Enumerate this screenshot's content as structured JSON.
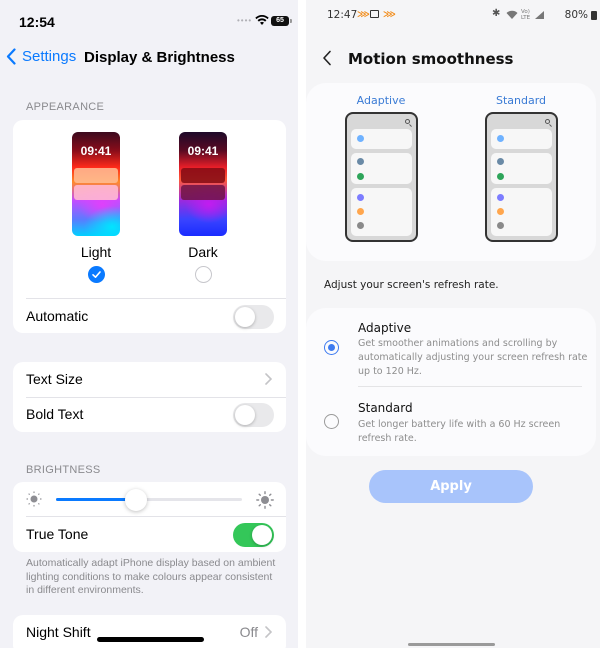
{
  "ios": {
    "status": {
      "time": "12:54",
      "battery": "65",
      "signal_icon": "cellular-dots-icon",
      "wifi_icon": "wifi-icon"
    },
    "nav": {
      "back_label": "Settings",
      "title": "Display & Brightness"
    },
    "appearance": {
      "section_label": "APPEARANCE",
      "options": [
        {
          "label": "Light",
          "preview_time": "09:41",
          "selected": true
        },
        {
          "label": "Dark",
          "preview_time": "09:41",
          "selected": false
        }
      ],
      "automatic": {
        "label": "Automatic",
        "on": false
      }
    },
    "text": {
      "text_size": {
        "label": "Text Size"
      },
      "bold_text": {
        "label": "Bold Text",
        "on": false
      }
    },
    "brightness": {
      "section_label": "BRIGHTNESS",
      "level": 0.43,
      "true_tone": {
        "label": "True Tone",
        "on": true
      },
      "footnote": "Automatically adapt iPhone display based on ambient lighting conditions to make colours appear consistent in different environments."
    },
    "night_shift": {
      "label": "Night Shift",
      "value": "Off"
    },
    "colors": {
      "accent": "#0a7aff",
      "toggle_on": "#34c759"
    }
  },
  "samsung": {
    "status": {
      "time": "12:47",
      "battery": "80%"
    },
    "header": {
      "title": "Motion smoothness"
    },
    "preview": {
      "adaptive_label": "Adaptive",
      "standard_label": "Standard",
      "dot_colors": [
        "#6fb2ff",
        "#6a8aa6",
        "#2ea55a",
        "#7d7dff",
        "#ffa64d",
        "#8a8a8a"
      ]
    },
    "description": "Adjust your screen's refresh rate.",
    "options": [
      {
        "title": "Adaptive",
        "desc": "Get smoother animations and scrolling by automatically adjusting your screen refresh rate up to 120 Hz.",
        "selected": true
      },
      {
        "title": "Standard",
        "desc": "Get longer battery life with a 60 Hz screen refresh rate.",
        "selected": false
      }
    ],
    "apply_label": "Apply",
    "colors": {
      "accent": "#3e7bf0",
      "apply_disabled": "#a8c4fb"
    }
  }
}
